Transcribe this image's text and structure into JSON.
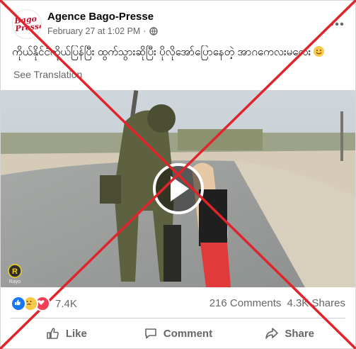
{
  "post": {
    "page_name": "Agence Bago-Presse",
    "logo_text_line1": "Bago",
    "logo_text_line2": "Presse",
    "timestamp": "February 27 at 1:02 PM",
    "separator": "·",
    "audience_icon": "globe-icon",
    "more_icon": "ellipsis-icon",
    "caption": "ကိုယ်နိုင်ငံကိုယ်ပြန်ပြီး ထွက်သွားဆိုပြီး ပိုလိုအော်ပြောနေတဲ့ အာဂကေလးမလေး",
    "see_translation": "See Translation"
  },
  "video": {
    "watermark": "R",
    "watermark_caption": "Rayo"
  },
  "stats": {
    "reaction_count": "7.4K",
    "comments": "216 Comments",
    "shares": "4.3K Shares"
  },
  "actions": {
    "like": "Like",
    "comment": "Comment",
    "share": "Share"
  },
  "colors": {
    "x_overlay": "#e0242b",
    "like_blue": "#1877f2",
    "sad_yellow": "#f7c948",
    "love_red": "#f33e58"
  }
}
